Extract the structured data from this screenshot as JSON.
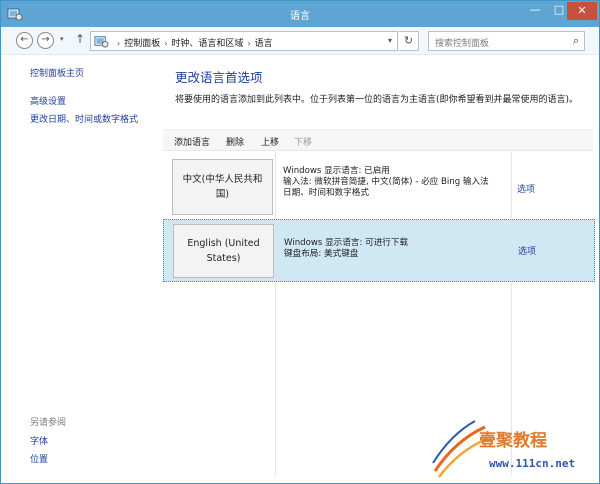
{
  "window": {
    "title": "语言",
    "minimize": "—",
    "maximize": "□",
    "close": "✕"
  },
  "nav": {
    "back": "←",
    "forward": "→",
    "recent": "▾",
    "up": "↑",
    "breadcrumbs": [
      "控制面板",
      "时钟、语言和区域",
      "语言"
    ],
    "separator": "›",
    "dropdown": "▾",
    "refresh": "↻",
    "search_placeholder": "搜索控制面板",
    "search_icon": "⌕"
  },
  "sidebar": {
    "home": "控制面板主页",
    "advanced": "高级设置",
    "datetime": "更改日期、时间或数字格式",
    "see_also": "另请参阅",
    "fonts": "字体",
    "location": "位置"
  },
  "main": {
    "title": "更改语言首选项",
    "description": "将要使用的语言添加到此列表中。位于列表第一位的语言为主语言(即你希望看到并最常使用的语言)。"
  },
  "toolbar": {
    "add": "添加语言",
    "delete": "删除",
    "move_up": "上移",
    "move_down": "下移"
  },
  "languages": [
    {
      "name": "中文(中华人民共和国)",
      "line1": "Windows 显示语言: 已启用",
      "line2": "输入法: 微软拼音简捷, 中文(简体) - 必应 Bing 输入法",
      "line3": "日期、时间和数字格式",
      "options": "选项"
    },
    {
      "name": "English (United States)",
      "line1": "Windows 显示语言: 可进行下载",
      "line2": "键盘布局: 美式键盘",
      "options": "选项"
    }
  ],
  "watermark": {
    "name": "壹聚教程",
    "url": "www.111cn.net"
  },
  "colors": {
    "titlebar": "#5ea5d4",
    "link": "#1e3f9e",
    "selected_row": "#d0e8f4",
    "close_button": "#c7503f"
  }
}
